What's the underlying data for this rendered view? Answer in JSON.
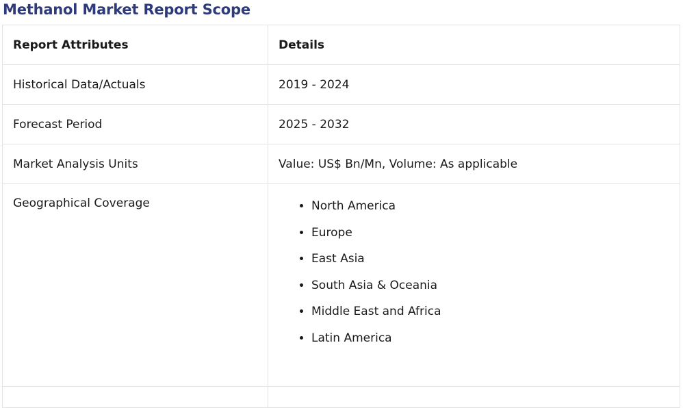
{
  "title": "Methanol Market Report Scope",
  "table": {
    "headers": [
      "Report Attributes",
      "Details"
    ],
    "rows": [
      {
        "attribute": "Historical Data/Actuals",
        "detail": "2019 - 2024"
      },
      {
        "attribute": "Forecast Period",
        "detail": "2025 - 2032"
      },
      {
        "attribute": "Market Analysis Units",
        "detail": "Value: US$ Bn/Mn, Volume: As applicable"
      }
    ],
    "geo": {
      "attribute": "Geographical Coverage",
      "regions": [
        "North America",
        "Europe",
        "East Asia",
        "South Asia & Oceania",
        "Middle East and Africa",
        "Latin America"
      ]
    }
  },
  "colors": {
    "title": "#2e3a7a",
    "border": "#e3e3e3"
  }
}
